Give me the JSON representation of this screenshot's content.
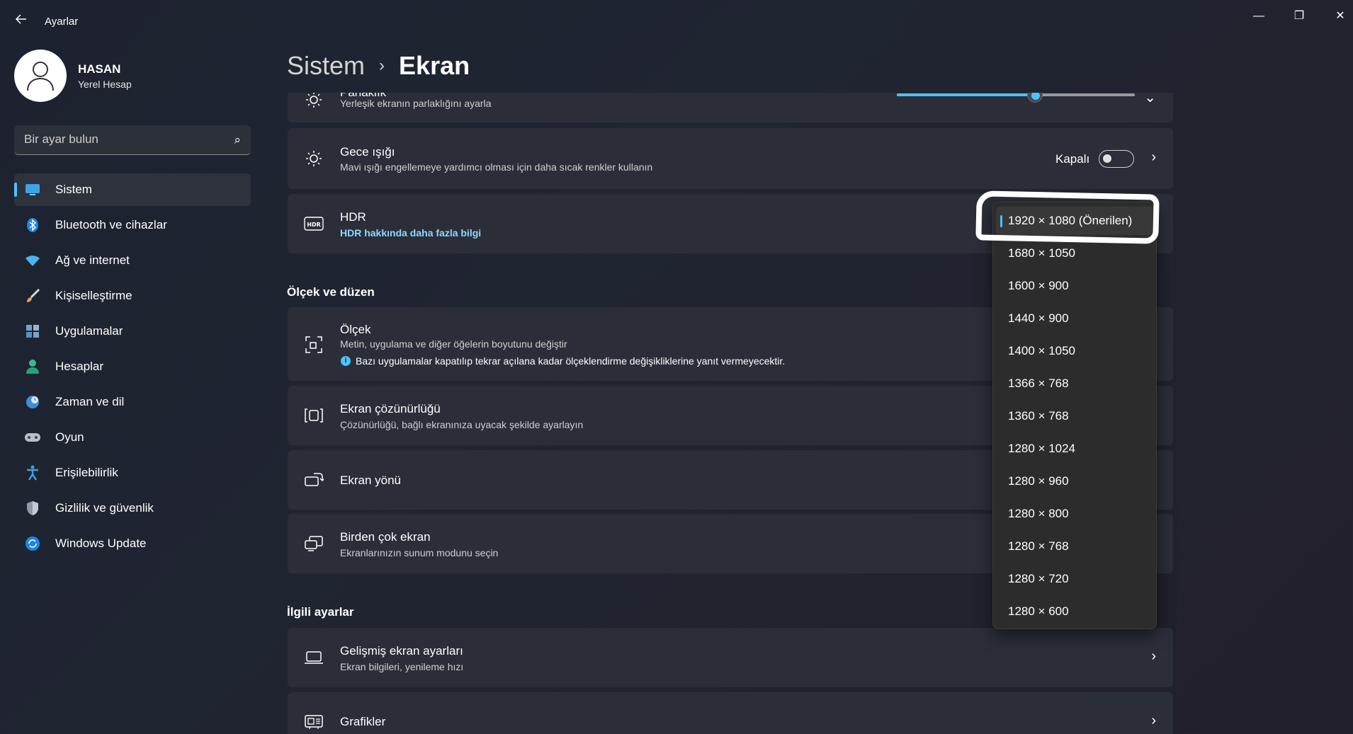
{
  "window": {
    "title": "Ayarlar",
    "back_icon": "arrow-left-icon",
    "minimize": "—",
    "maximize": "❐",
    "close": "✕"
  },
  "profile": {
    "name": "HASAN",
    "account_type": "Yerel Hesap"
  },
  "search": {
    "placeholder": "Bir ayar bulun"
  },
  "sidebar": {
    "items": [
      {
        "label": "Sistem",
        "icon": "monitor-icon",
        "active": true
      },
      {
        "label": "Bluetooth ve cihazlar",
        "icon": "bluetooth-icon"
      },
      {
        "label": "Ağ ve internet",
        "icon": "wifi-icon"
      },
      {
        "label": "Kişiselleştirme",
        "icon": "brush-icon"
      },
      {
        "label": "Uygulamalar",
        "icon": "apps-icon"
      },
      {
        "label": "Hesaplar",
        "icon": "person-icon"
      },
      {
        "label": "Zaman ve dil",
        "icon": "globe-clock-icon"
      },
      {
        "label": "Oyun",
        "icon": "gamepad-icon"
      },
      {
        "label": "Erişilebilirlik",
        "icon": "accessibility-icon"
      },
      {
        "label": "Gizlilik ve güvenlik",
        "icon": "shield-icon"
      },
      {
        "label": "Windows Update",
        "icon": "update-icon"
      }
    ]
  },
  "breadcrumb": {
    "parent": "Sistem",
    "separator": "›",
    "current": "Ekran"
  },
  "brightness": {
    "title": "Parlaklık",
    "description": "Yerleşik ekranın parlaklığını ayarla",
    "level_percent": 58
  },
  "night_light": {
    "title": "Gece ışığı",
    "description": "Mavi ışığı engellemeye yardımcı olması için daha sıcak renkler kullanın",
    "state_label": "Kapalı",
    "on": false
  },
  "hdr": {
    "title": "HDR",
    "link": "HDR hakkında daha fazla bilgi",
    "icon_text": "HDR"
  },
  "scale_section": {
    "title": "Ölçek ve düzen"
  },
  "scale": {
    "title": "Ölçek",
    "description": "Metin, uygulama ve diğer öğelerin boyutunu değiştir",
    "info": "Bazı uygulamalar kapatılıp tekrar açılana kadar ölçeklendirme değişikliklerine yanıt vermeyecektir."
  },
  "resolution": {
    "title": "Ekran çözünürlüğü",
    "description": "Çözünürlüğü, bağlı ekranınıza uyacak şekilde ayarlayın"
  },
  "orientation": {
    "title": "Ekran yönü"
  },
  "multi_display": {
    "title": "Birden çok ekran",
    "description": "Ekranlarınızın sunum modunu seçin"
  },
  "related_section": {
    "title": "İlgili ayarlar"
  },
  "advanced_display": {
    "title": "Gelişmiş ekran ayarları",
    "description": "Ekran bilgileri, yenileme hızı"
  },
  "graphics": {
    "title": "Grafikler"
  },
  "resolution_dropdown": {
    "options": [
      "1920 × 1080 (Önerilen)",
      "1680 × 1050",
      "1600 × 900",
      "1440 × 900",
      "1400 × 1050",
      "1366 × 768",
      "1360 × 768",
      "1280 × 1024",
      "1280 × 960",
      "1280 × 800",
      "1280 × 768",
      "1280 × 720",
      "1280 × 600"
    ],
    "selected_index": 0
  },
  "colors": {
    "accent": "#4cc2ff",
    "card": "#2b2e38",
    "flyout": "#2c2c2c"
  }
}
